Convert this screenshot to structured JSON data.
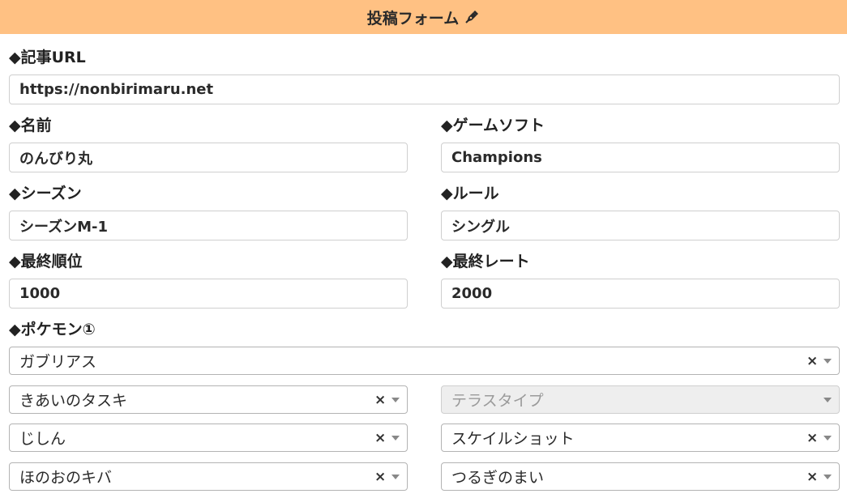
{
  "header": {
    "title": "投稿フォーム",
    "icon": "pen-icon"
  },
  "fields": {
    "article_url": {
      "label": "◆記事URL",
      "value": "https://nonbirimaru.net"
    },
    "name": {
      "label": "◆名前",
      "value": "のんびり丸"
    },
    "game_soft": {
      "label": "◆ゲームソフト",
      "value": "Champions"
    },
    "season": {
      "label": "◆シーズン",
      "value": "シーズンM-1"
    },
    "rule": {
      "label": "◆ルール",
      "value": "シングル"
    },
    "final_rank": {
      "label": "◆最終順位",
      "value": "1000"
    },
    "final_rate": {
      "label": "◆最終レート",
      "value": "2000"
    }
  },
  "pokemon1": {
    "label": "◆ポケモン①",
    "species": "ガブリアス",
    "item": "きあいのタスキ",
    "tera_type_placeholder": "テラスタイプ",
    "moves": [
      "じしん",
      "スケイルショット",
      "ほのおのキバ",
      "つるぎのまい"
    ]
  },
  "colors": {
    "header_bg": "#ffc183",
    "disabled_bg": "#eeeeee"
  }
}
